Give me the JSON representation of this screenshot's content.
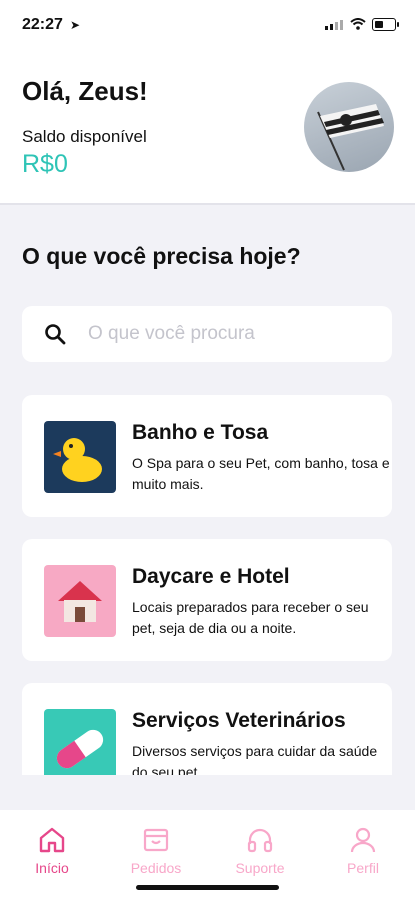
{
  "status_bar": {
    "time": "22:27"
  },
  "header": {
    "greeting": "Olá, Zeus!",
    "balance_label": "Saldo disponível",
    "balance_value": "R$0"
  },
  "main": {
    "question": "O que você precisa hoje?",
    "search": {
      "placeholder": "O que você procura"
    },
    "services": [
      {
        "title": "Banho e Tosa",
        "description": "O Spa para o seu Pet, com banho, tosa e muito mais.",
        "icon": "duck-icon",
        "color": "#1c3a5c"
      },
      {
        "title": "Daycare e Hotel",
        "description": "Locais preparados para receber o seu pet, seja de dia ou a noite.",
        "icon": "house-icon",
        "color": "#f7a9c4"
      },
      {
        "title": "Serviços Veterinários",
        "description": "Diversos serviços para cuidar da saúde do seu pet.",
        "icon": "pill-icon",
        "color": "#38c9b6"
      }
    ]
  },
  "tabbar": {
    "tabs": [
      {
        "label": "Início",
        "icon": "home-icon",
        "active": true
      },
      {
        "label": "Pedidos",
        "icon": "box-icon",
        "active": false
      },
      {
        "label": "Suporte",
        "icon": "headphones-icon",
        "active": false
      },
      {
        "label": "Perfil",
        "icon": "user-icon",
        "active": false
      }
    ]
  },
  "colors": {
    "accent": "#e6478a",
    "balance": "#2ec4b6",
    "tab_inactive": "#f8a7c9"
  }
}
